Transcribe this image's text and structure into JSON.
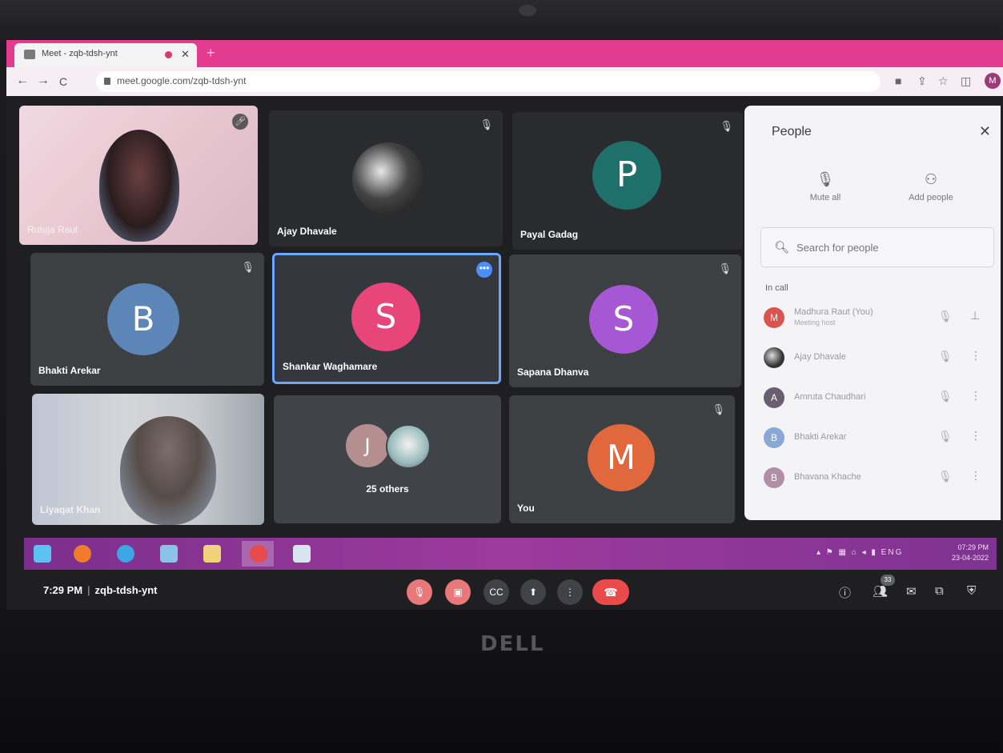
{
  "browser": {
    "tab_title": "Meet - zqb-tdsh-ynt",
    "url": "meet.google.com/zqb-tdsh-ynt",
    "profile_initial": "M"
  },
  "tiles": [
    {
      "name": "Rutuja Raut",
      "type": "video"
    },
    {
      "name": "Ajay Dhavale",
      "type": "photo"
    },
    {
      "name": "Payal Gadag",
      "initial": "P",
      "color": "#1f6f6b"
    },
    {
      "name": "Bhakti Arekar",
      "initial": "B",
      "color": "#5b86b7"
    },
    {
      "name": "Shankar Waghamare",
      "initial": "S",
      "color": "#e8457a"
    },
    {
      "name": "Sapana Dhanva",
      "initial": "S",
      "color": "#a657d3"
    },
    {
      "name": "Liyaqat Khan",
      "type": "video"
    },
    {
      "name": "25 others",
      "initial": "J",
      "color": "#b58f8f"
    },
    {
      "name": "You",
      "initial": "M",
      "color": "#e0683c"
    }
  ],
  "meeting": {
    "time": "7:29 PM",
    "code": "zqb-tdsh-ynt",
    "participants_badge": "33"
  },
  "people_panel": {
    "title": "People",
    "mute_all": "Mute all",
    "add_people": "Add people",
    "search_placeholder": "Search for people",
    "section_label": "In call",
    "people": [
      {
        "name": "Madhura Raut (You)",
        "sub": "Meeting host",
        "initial": "M",
        "color": "#d9534f"
      },
      {
        "name": "Ajay Dhavale",
        "sub": "",
        "initial": "",
        "color": "#3b3b3b"
      },
      {
        "name": "Amruta Chaudhari",
        "sub": "",
        "initial": "A",
        "color": "#6a5e70"
      },
      {
        "name": "Bhakti Arekar",
        "sub": "",
        "initial": "B",
        "color": "#8aa8d6"
      },
      {
        "name": "Bhavana Khache",
        "sub": "",
        "initial": "B",
        "color": "#b28ea6"
      }
    ]
  },
  "taskbar": {
    "tray_lang": "ENG",
    "clock_time": "07:29 PM",
    "clock_date": "23-04-2022"
  },
  "laptop_brand": "DELL"
}
